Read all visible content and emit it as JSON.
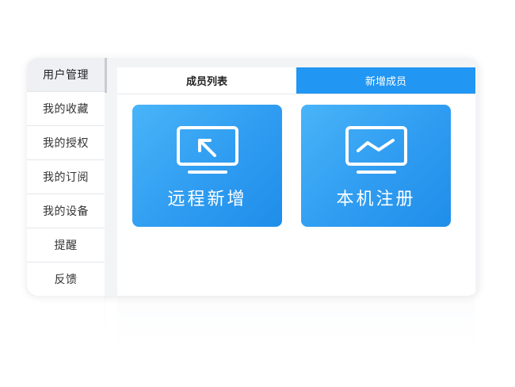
{
  "sidebar": {
    "items": [
      {
        "label": "用户管理",
        "active": true
      },
      {
        "label": "我的收藏"
      },
      {
        "label": "我的授权"
      },
      {
        "label": "我的订阅"
      },
      {
        "label": "我的设备"
      },
      {
        "label": "提醒"
      },
      {
        "label": "反馈"
      }
    ]
  },
  "tabs": [
    {
      "label": "成员列表",
      "active": false
    },
    {
      "label": "新增成员",
      "active": true
    }
  ],
  "tiles": [
    {
      "label": "远程新增",
      "icon": "monitor-arrow-icon"
    },
    {
      "label": "本机注册",
      "icon": "monitor-chart-icon"
    }
  ],
  "colors": {
    "accent": "#2196f3",
    "tile_start": "#49b4f8",
    "tile_end": "#1f8eea"
  }
}
